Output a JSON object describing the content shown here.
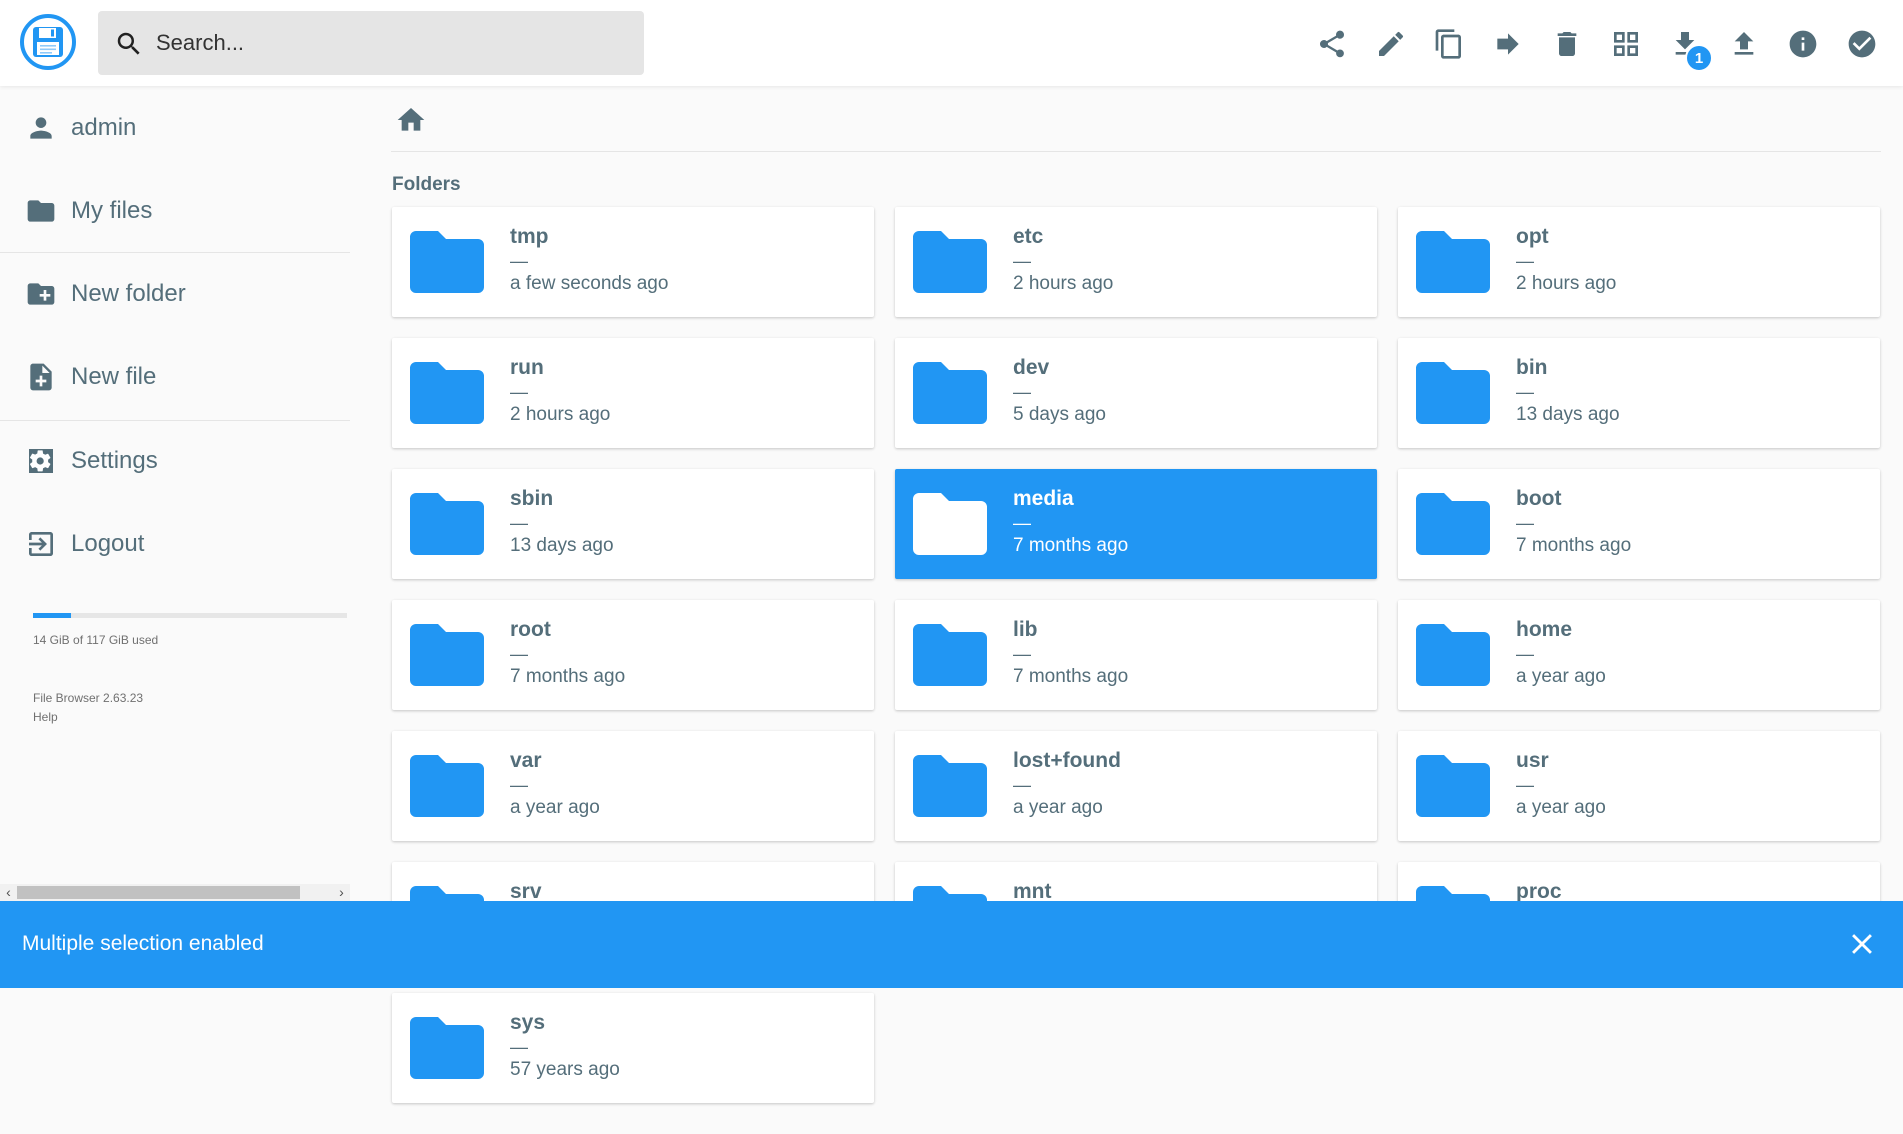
{
  "app": {
    "title": "File Browser"
  },
  "colors": {
    "accent": "#2196f3",
    "text": "#546e7a",
    "selected_text": "#ffffff"
  },
  "search": {
    "placeholder": "Search..."
  },
  "toolbar": {
    "buttons": [
      {
        "name": "share",
        "icon": "share-icon"
      },
      {
        "name": "rename",
        "icon": "pencil-icon"
      },
      {
        "name": "copy",
        "icon": "copy-icon"
      },
      {
        "name": "move",
        "icon": "arrow-right-icon"
      },
      {
        "name": "delete",
        "icon": "trash-icon"
      },
      {
        "name": "switch-view",
        "icon": "grid-view-icon"
      },
      {
        "name": "download",
        "icon": "download-icon",
        "badge": "1"
      },
      {
        "name": "upload",
        "icon": "upload-icon"
      },
      {
        "name": "info",
        "icon": "info-icon"
      },
      {
        "name": "select-multiple",
        "icon": "check-circle-icon"
      }
    ]
  },
  "sidebar": {
    "items": [
      {
        "label": "admin",
        "icon": "person-icon"
      },
      {
        "label": "My files",
        "icon": "folder-icon"
      },
      {
        "label": "New folder",
        "icon": "new-folder-icon"
      },
      {
        "label": "New file",
        "icon": "new-file-icon"
      },
      {
        "label": "Settings",
        "icon": "settings-icon"
      },
      {
        "label": "Logout",
        "icon": "logout-icon"
      }
    ],
    "quota": {
      "text": "14 GiB of 117 GiB used",
      "used_fraction": 0.12
    },
    "credits": {
      "version": "File Browser 2.63.23",
      "help": "Help"
    }
  },
  "main": {
    "section_title": "Folders",
    "folders": [
      {
        "name": "tmp",
        "size": "—",
        "modified": "a few seconds ago",
        "selected": false
      },
      {
        "name": "etc",
        "size": "—",
        "modified": "2 hours ago",
        "selected": false
      },
      {
        "name": "opt",
        "size": "—",
        "modified": "2 hours ago",
        "selected": false
      },
      {
        "name": "run",
        "size": "—",
        "modified": "2 hours ago",
        "selected": false
      },
      {
        "name": "dev",
        "size": "—",
        "modified": "5 days ago",
        "selected": false
      },
      {
        "name": "bin",
        "size": "—",
        "modified": "13 days ago",
        "selected": false
      },
      {
        "name": "sbin",
        "size": "—",
        "modified": "13 days ago",
        "selected": false
      },
      {
        "name": "media",
        "size": "—",
        "modified": "7 months ago",
        "selected": true
      },
      {
        "name": "boot",
        "size": "—",
        "modified": "7 months ago",
        "selected": false
      },
      {
        "name": "root",
        "size": "—",
        "modified": "7 months ago",
        "selected": false
      },
      {
        "name": "lib",
        "size": "—",
        "modified": "7 months ago",
        "selected": false
      },
      {
        "name": "home",
        "size": "—",
        "modified": "a year ago",
        "selected": false
      },
      {
        "name": "var",
        "size": "—",
        "modified": "a year ago",
        "selected": false
      },
      {
        "name": "lost+found",
        "size": "—",
        "modified": "a year ago",
        "selected": false
      },
      {
        "name": "usr",
        "size": "—",
        "modified": "a year ago",
        "selected": false
      },
      {
        "name": "srv",
        "size": "",
        "modified": "",
        "selected": false
      },
      {
        "name": "mnt",
        "size": "",
        "modified": "",
        "selected": false
      },
      {
        "name": "proc",
        "size": "",
        "modified": "",
        "selected": false
      },
      {
        "name": "sys",
        "size": "—",
        "modified": "57 years ago",
        "selected": false
      }
    ]
  },
  "snackbar": {
    "message": "Multiple selection enabled"
  }
}
